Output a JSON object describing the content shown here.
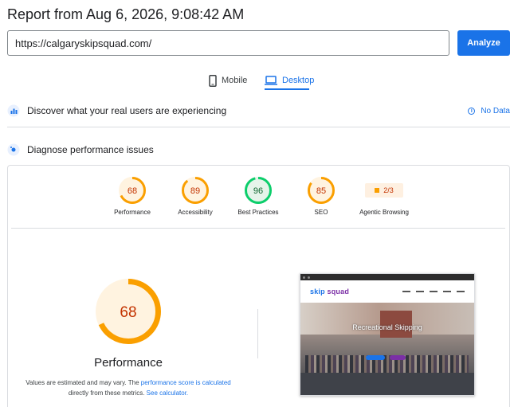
{
  "report": {
    "title": "Report from Aug 6, 2026, 9:08:42 AM"
  },
  "search": {
    "url": "https://calgaryskipsquad.com/",
    "analyze_label": "Analyze"
  },
  "tabs": [
    {
      "label": "Mobile",
      "icon": "phone-icon",
      "active": false
    },
    {
      "label": "Desktop",
      "icon": "laptop-icon",
      "active": true
    }
  ],
  "field_data": {
    "title": "Discover what your real users are experiencing",
    "status": "No Data"
  },
  "diagnose": {
    "title": "Diagnose performance issues"
  },
  "scores": [
    {
      "label": "Performance",
      "value": 68,
      "color": "#fa9f00"
    },
    {
      "label": "Accessibility",
      "value": 89,
      "color": "#fa9f00"
    },
    {
      "label": "Best Practices",
      "value": 96,
      "color": "#0cce6b"
    },
    {
      "label": "SEO",
      "value": 85,
      "color": "#fa9f00"
    }
  ],
  "agentic": {
    "label": "Agentic Browsing",
    "value": "2/3"
  },
  "main_gauge": {
    "value": "68",
    "label": "Performance",
    "score": 68,
    "color": "#fa9f00"
  },
  "footnote": {
    "prefix": "Values are estimated and may vary. The ",
    "link1": "performance score is calculated",
    "middle": " directly from these metrics. ",
    "link2": "See calculator."
  },
  "thumbnail": {
    "logo_a": "skip",
    "logo_b": " squad",
    "hero_title": "Recreational Skipping"
  },
  "colors": {
    "accent": "#1a73e8",
    "average": "#fa9f00",
    "pass": "#0cce6b"
  }
}
